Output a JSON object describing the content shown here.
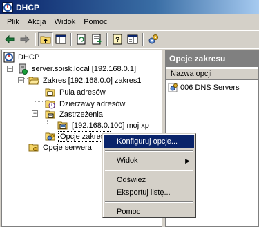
{
  "window": {
    "title": "DHCP"
  },
  "menu": [
    "Plik",
    "Akcja",
    "Widok",
    "Pomoc"
  ],
  "tree": {
    "root": "DHCP",
    "server": "server.soisk.local [192.168.0.1]",
    "scope": "Zakres [192.168.0.0] zakres1",
    "address_pool": "Pula adresów",
    "leases": "Dzierżawy adresów",
    "reservations": "Zastrzeżenia",
    "reservation_item": "[192.168.0.100] moj xp",
    "scope_options": "Opcje zakresu",
    "server_options": "Opcje serwera"
  },
  "right_pane": {
    "header": "Opcje zakresu",
    "column": "Nazwa opcji",
    "rows": [
      "006 DNS Servers"
    ]
  },
  "context_menu": {
    "configure": "Konfiguruj opcje...",
    "view": "Widok",
    "refresh": "Odśwież",
    "export": "Eksportuj listę...",
    "help": "Pomoc"
  }
}
